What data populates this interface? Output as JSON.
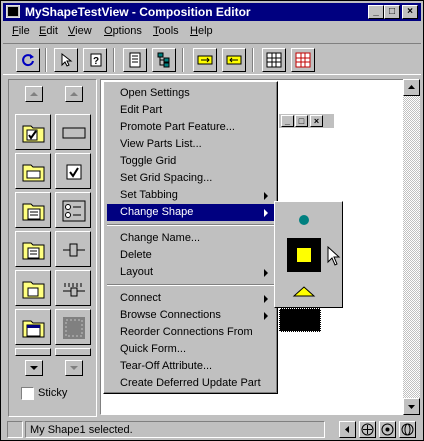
{
  "window": {
    "title": "MyShapeTestView - Composition Editor",
    "controls": {
      "minimize": "_",
      "maximize": "□",
      "close": "×"
    }
  },
  "menubar": {
    "items": [
      {
        "label": "File",
        "accel": "F",
        "rest": "ile"
      },
      {
        "label": "Edit",
        "accel": "E",
        "rest": "dit"
      },
      {
        "label": "View",
        "accel": "V",
        "rest": "iew"
      },
      {
        "label": "Options",
        "accel": "O",
        "rest": "ptions"
      },
      {
        "label": "Tools",
        "accel": "T",
        "rest": "ools"
      },
      {
        "label": "Help",
        "accel": "H",
        "rest": "elp"
      }
    ]
  },
  "toolbar": {
    "icons": [
      "refresh-icon",
      "select-arrow-icon",
      "help-pointer-icon",
      "properties-icon",
      "tree-icon",
      "connect-icon",
      "disconnect-icon",
      "grid-icon",
      "grid-red-icon"
    ]
  },
  "palette": {
    "sticky_label": "Sticky",
    "sticky_checked": false
  },
  "context_menu": {
    "items": [
      {
        "label": "Open Settings",
        "submenu": false
      },
      {
        "label": "Edit Part",
        "submenu": false
      },
      {
        "label": "Promote Part Feature...",
        "submenu": false
      },
      {
        "label": "View Parts List...",
        "submenu": false
      },
      {
        "label": "Toggle Grid",
        "submenu": false
      },
      {
        "label": "Set Grid Spacing...",
        "submenu": false
      },
      {
        "label": "Set Tabbing",
        "submenu": true
      },
      {
        "label": "Change Shape",
        "submenu": true,
        "selected": true
      },
      {
        "separator": true
      },
      {
        "label": "Change Name...",
        "submenu": false
      },
      {
        "label": "Delete",
        "submenu": false
      },
      {
        "label": "Layout",
        "submenu": true
      },
      {
        "separator": true
      },
      {
        "label": "Connect",
        "submenu": true
      },
      {
        "label": "Browse Connections",
        "submenu": true
      },
      {
        "label": "Reorder Connections From",
        "submenu": false
      },
      {
        "label": "Quick Form...",
        "submenu": false
      },
      {
        "label": "Tear-Off Attribute...",
        "submenu": false
      },
      {
        "label": "Create Deferred Update Part",
        "submenu": false
      }
    ]
  },
  "shape_submenu": {
    "items": [
      "circle-shape",
      "square-shape",
      "triangle-shape"
    ],
    "colors": {
      "teal": "#008080",
      "yellow": "#ffff00"
    }
  },
  "status": {
    "text": "My Shape1 selected."
  }
}
